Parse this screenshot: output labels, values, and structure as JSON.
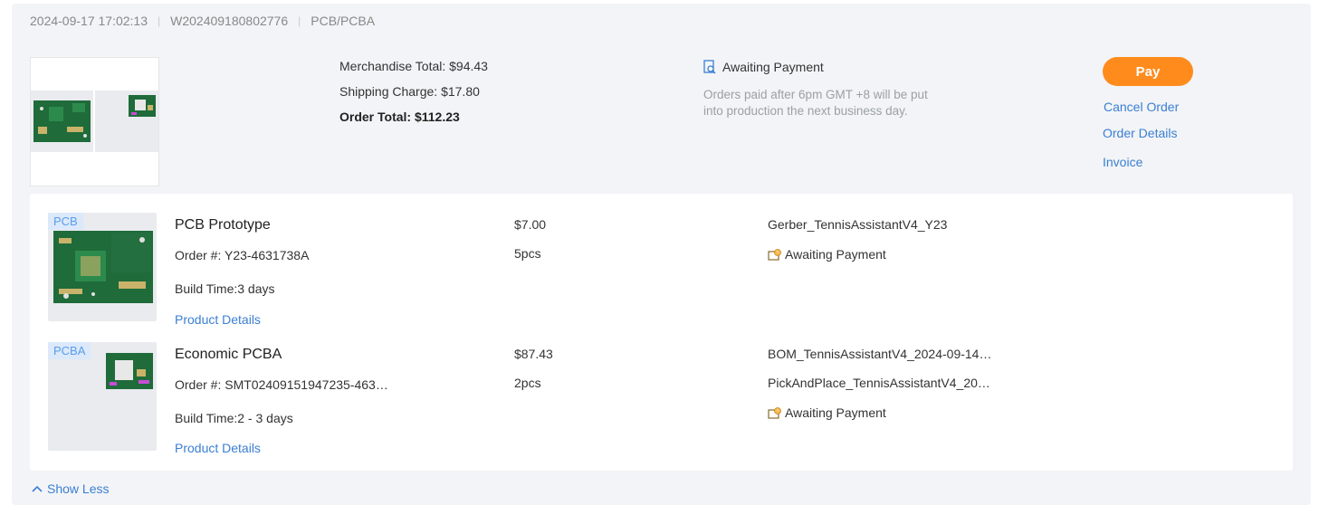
{
  "order": {
    "datetime": "2024-09-17 17:02:13",
    "order_id": "W202409180802776",
    "category": "PCB/PCBA",
    "merchandise_total": "Merchandise Total: $94.43",
    "shipping_charge": "Shipping Charge: $17.80",
    "order_total": "Order Total: $112.23",
    "status": "Awaiting Payment",
    "status_note": "Orders paid after 6pm GMT +8 will be put into production the next business day.",
    "actions": {
      "pay": "Pay",
      "cancel": "Cancel Order",
      "details": "Order Details",
      "invoice": "Invoice"
    }
  },
  "items": [
    {
      "tag": "PCB",
      "name": "PCB Prototype",
      "order_no": "Order #: Y23-4631738A",
      "build_time": "Build Time:3 days",
      "details_link": "Product Details",
      "price": "$7.00",
      "qty": "5pcs",
      "files": [
        "Gerber_TennisAssistantV4_Y23"
      ],
      "status": "Awaiting Payment"
    },
    {
      "tag": "PCBA",
      "name": "Economic PCBA",
      "order_no": "Order #: SMT02409151947235-463…",
      "build_time": "Build Time:2 - 3 days",
      "details_link": "Product Details",
      "price": "$87.43",
      "qty": "2pcs",
      "files": [
        "BOM_TennisAssistantV4_2024-09-14…",
        "PickAndPlace_TennisAssistantV4_20…"
      ],
      "status": "Awaiting Payment"
    }
  ],
  "footer": {
    "show_less": "Show Less"
  },
  "colors": {
    "accent": "#ff8b1d",
    "link": "#3a7fd3",
    "pcb_green": "#1f6b3a"
  }
}
